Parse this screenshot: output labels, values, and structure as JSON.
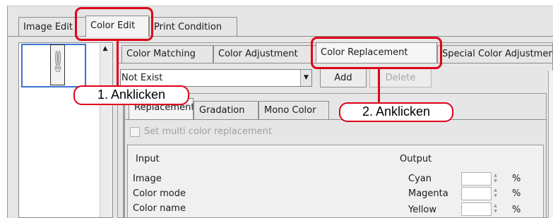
{
  "main_tabs": [
    "Image Edit",
    "Color Edit",
    "Print Condition"
  ],
  "sub_tabs": [
    "Color Matching",
    "Color Adjustment",
    "Color Replacement",
    "Special Color Adjustment"
  ],
  "selector": {
    "value": "Not Exist"
  },
  "buttons": {
    "add": "Add",
    "delete": "Delete"
  },
  "inner_tabs": [
    "Replacement",
    "Gradation",
    "Mono Color"
  ],
  "checkbox": {
    "label": "Set multi color replacement"
  },
  "input": {
    "header": "Input",
    "rows": [
      "Image",
      "Color mode",
      "Color name"
    ]
  },
  "output": {
    "header": "Output",
    "rows": [
      {
        "label": "Cyan",
        "unit": "%"
      },
      {
        "label": "Magenta",
        "unit": "%"
      },
      {
        "label": "Yellow",
        "unit": "%"
      }
    ]
  },
  "callouts": {
    "first": "1. Anklicken",
    "second": "2. Anklicken"
  },
  "colors": {
    "highlight": "#e0001a",
    "selection": "#3a72d6"
  }
}
